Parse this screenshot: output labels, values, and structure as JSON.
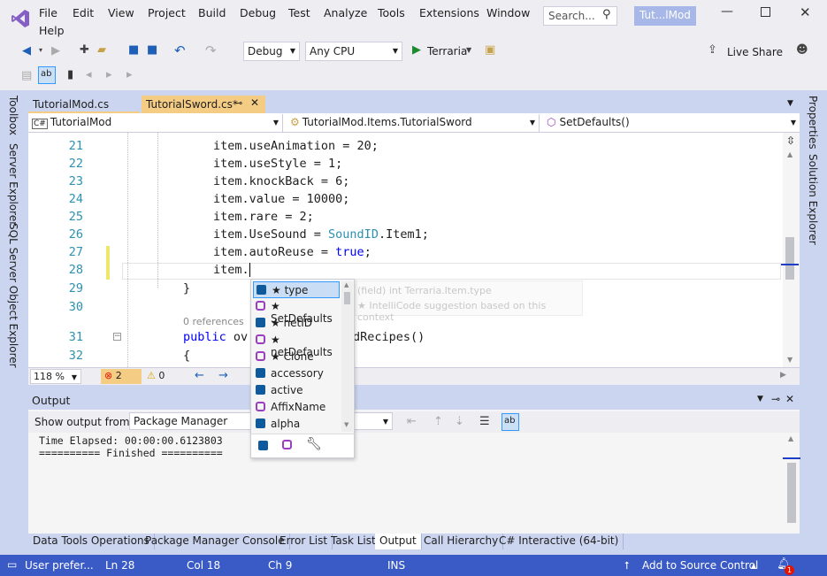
{
  "menu": {
    "items": [
      "File",
      "Edit",
      "View",
      "Project",
      "Build",
      "Debug",
      "Test",
      "Analyze",
      "Tools",
      "Extensions",
      "Window",
      "Help"
    ],
    "search_placeholder": "Search...",
    "solution_name": "Tut...lMod"
  },
  "toolbar": {
    "config": "Debug",
    "platform": "Any CPU",
    "start_label": "Terraria",
    "live_share": "Live Share"
  },
  "side_left": [
    "Toolbox",
    "Server Explorer",
    "SQL Server Object Explorer"
  ],
  "side_right": [
    "Properties",
    "Solution Explorer"
  ],
  "tabs": [
    {
      "label": "TutorialMod.cs"
    },
    {
      "label": "TutorialSword.cs*"
    }
  ],
  "nav": {
    "project": "TutorialMod",
    "type": "TutorialMod.Items.TutorialSword",
    "member": "SetDefaults()"
  },
  "code_lines": [
    {
      "num": "21",
      "code": "item.useAnimation = 20;"
    },
    {
      "num": "22",
      "code": "item.useStyle = 1;"
    },
    {
      "num": "23",
      "code": "item.knockBack = 6;"
    },
    {
      "num": "24",
      "code": "item.value = 10000;"
    },
    {
      "num": "25",
      "code": "item.rare = 2;"
    },
    {
      "num": "26",
      "pre": "item.UseSound = ",
      "ty": "SoundID",
      "post": ".Item1;"
    },
    {
      "num": "27",
      "pre": "item.autoReuse = ",
      "kw": "true",
      "post": ";"
    },
    {
      "num": "28",
      "code": "item."
    },
    {
      "num": "29",
      "code": "}"
    },
    {
      "num": "30",
      "code": ""
    },
    {
      "num": "31",
      "kw": "public",
      "post": " ov"
    },
    {
      "num": "32",
      "code": "{"
    }
  ],
  "references_hint": "0 references",
  "line31_tail": "dRecipes()",
  "tooltip": {
    "line1": "(field) int Terraria.Item.type",
    "line2": "★ IntelliCode suggestion based on this context"
  },
  "completion": {
    "items": [
      {
        "label": "★ type",
        "icon": "field-icon",
        "selected": true
      },
      {
        "label": "★ SetDefaults",
        "icon": "method-icon"
      },
      {
        "label": "★ netID",
        "icon": "field-icon"
      },
      {
        "label": "★ netDefaults",
        "icon": "method-icon"
      },
      {
        "label": "★ Clone",
        "icon": "method-icon"
      },
      {
        "label": "accessory",
        "icon": "field-icon"
      },
      {
        "label": "active",
        "icon": "field-icon"
      },
      {
        "label": "AffixName",
        "icon": "method-icon"
      },
      {
        "label": "alpha",
        "icon": "field-icon"
      }
    ]
  },
  "editor_status": {
    "zoom": "118 %",
    "errors": "2",
    "warnings": "0"
  },
  "output": {
    "title": "Output",
    "show_from_label": "Show output from:",
    "source": "Package Manager",
    "lines": [
      "Time Elapsed: 00:00:00.6123803",
      "========== Finished =========="
    ]
  },
  "bottom_tabs": [
    "Data Tools Operations",
    "Package Manager Console",
    "Error List",
    "Task List",
    "Output",
    "Call Hierarchy",
    "C# Interactive (64-bit)"
  ],
  "status": {
    "message": "User prefer...",
    "ln": "Ln 28",
    "col": "Col 18",
    "ch": "Ch 9",
    "mode": "INS",
    "source_control": "Add to Source Control",
    "notifications": "1"
  },
  "colors": {
    "accent": "#3a5ac6",
    "active_tab": "#f5cc84",
    "keyword": "#0000ff",
    "type": "#2b91af"
  }
}
